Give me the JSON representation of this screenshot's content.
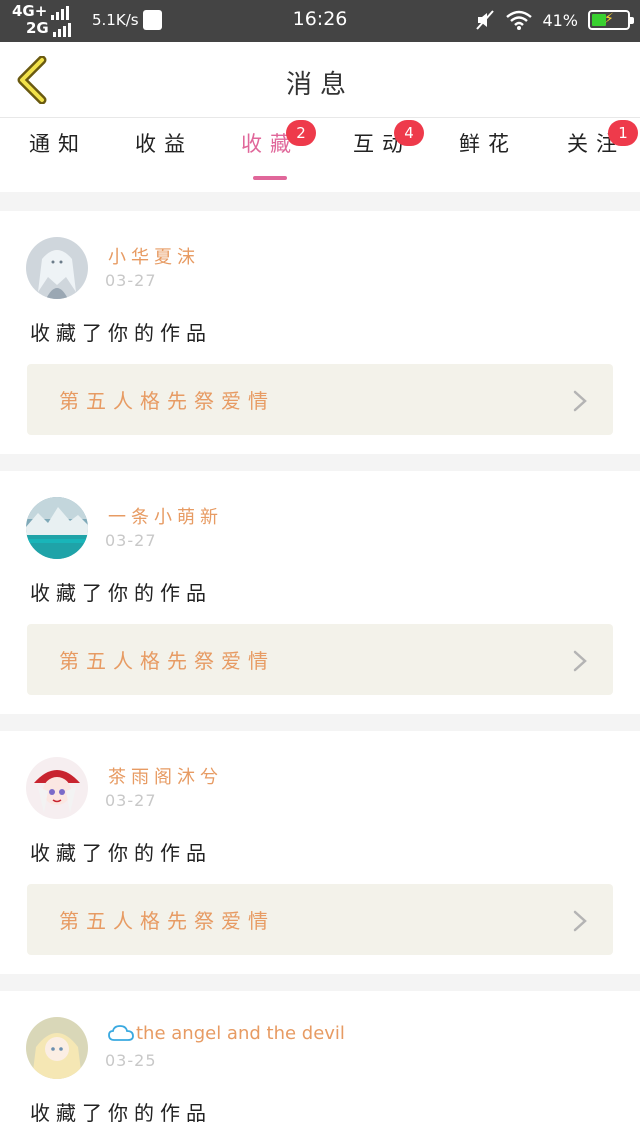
{
  "status_bar": {
    "network_top": "4G+",
    "network_bottom": "2G",
    "speed": "5.1K/s",
    "time": "16:26",
    "battery": "41%"
  },
  "header": {
    "title": "消息"
  },
  "tabs": [
    {
      "label": "通知",
      "badge": ""
    },
    {
      "label": "收益",
      "badge": ""
    },
    {
      "label": "收藏",
      "badge": "2",
      "active": true
    },
    {
      "label": "互动",
      "badge": "4"
    },
    {
      "label": "鲜花",
      "badge": ""
    },
    {
      "label": "关注",
      "badge": "1"
    }
  ],
  "colors": {
    "accent": "#e0679a",
    "badge": "#ee3a4b",
    "username": "#e79b63",
    "work_bg": "#f3f2ea"
  },
  "messages": [
    {
      "user": "小华夏沫",
      "date": "03-27",
      "action": "收藏了你的作品",
      "work": "第五人格先祭爱情",
      "avatar_icon": "anime-girl-white-hair-avatar"
    },
    {
      "user": "一条小萌新",
      "date": "03-27",
      "action": "收藏了你的作品",
      "work": "第五人格先祭爱情",
      "avatar_icon": "iceberg-landscape-avatar"
    },
    {
      "user": "茶雨阁沐兮",
      "date": "03-27",
      "action": "收藏了你的作品",
      "work": "第五人格先祭爱情",
      "avatar_icon": "anime-girl-red-hat-avatar"
    },
    {
      "user": "the angel and the devil",
      "date": "03-25",
      "action": "收藏了你的作品",
      "work": "",
      "avatar_icon": "anime-girl-blonde-avatar",
      "prefix_icon": "cloud-icon"
    }
  ]
}
